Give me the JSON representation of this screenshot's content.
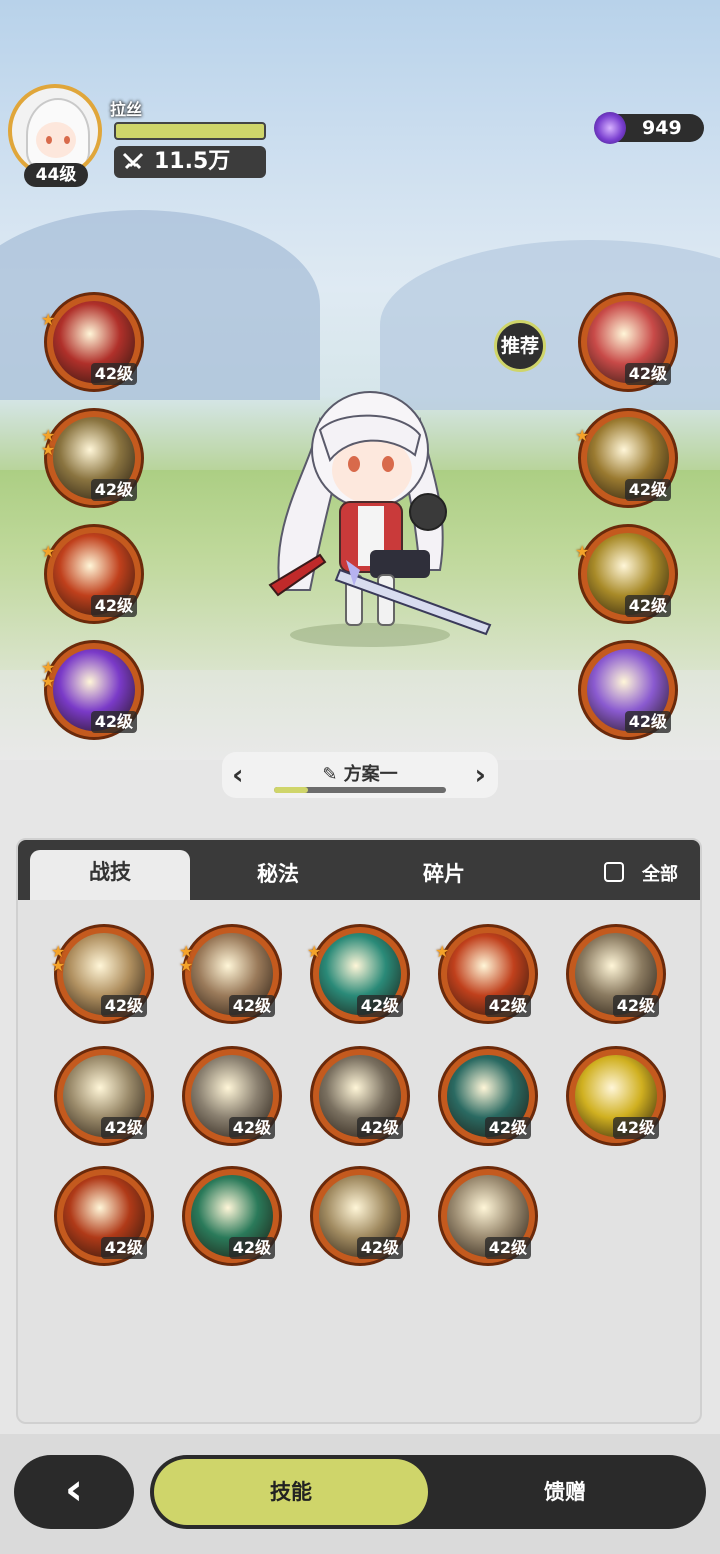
{
  "player": {
    "name": "拉丝",
    "level": "44级",
    "power": "11.5万",
    "hp_fraction": 1.0
  },
  "currency": {
    "value": "949",
    "icon": "purple-crystal-icon"
  },
  "recommend_label": "推荐",
  "left_skills": [
    {
      "level": "42级",
      "stars": 1,
      "icon": "sword-strike-icon",
      "color": "#b0302a"
    },
    {
      "level": "42级",
      "stars": 2,
      "icon": "slash-icon",
      "color": "#8a7440"
    },
    {
      "level": "42级",
      "stars": 1,
      "icon": "fire-rune-icon",
      "color": "#c0401c"
    },
    {
      "level": "42级",
      "stars": 2,
      "icon": "violet-orb-icon",
      "color": "#7a3ac8"
    }
  ],
  "right_skills": [
    {
      "level": "42级",
      "stars": 0,
      "icon": "red-sword-icon",
      "color": "#c84a48"
    },
    {
      "level": "42级",
      "stars": 1,
      "icon": "golden-sigil-icon",
      "color": "#9a7a30"
    },
    {
      "level": "42级",
      "stars": 1,
      "icon": "eye-icon",
      "color": "#a88a28"
    },
    {
      "level": "42级",
      "stars": 0,
      "icon": "purple-vortex-icon",
      "color": "#8a5ad0"
    }
  ],
  "plan": {
    "title": "方案一",
    "progress": 0.2
  },
  "tabs": [
    "战技",
    "秘法",
    "碎片"
  ],
  "all_label": "全部",
  "grid_skills": [
    {
      "level": "42级",
      "stars": 2,
      "icon": "burst-icon",
      "color": "#b09060"
    },
    {
      "level": "42级",
      "stars": 2,
      "icon": "explosion-icon",
      "color": "#9a7a5a"
    },
    {
      "level": "42级",
      "stars": 1,
      "icon": "teal-slash-icon",
      "color": "#2a8a78"
    },
    {
      "level": "42级",
      "stars": 1,
      "icon": "flame-icon",
      "color": "#c0401c"
    },
    {
      "level": "42级",
      "stars": 0,
      "icon": "crescent-icon",
      "color": "#8a7a60"
    },
    {
      "level": "42级",
      "stars": 0,
      "icon": "sword-up-icon",
      "color": "#9a8a6a"
    },
    {
      "level": "42级",
      "stars": 0,
      "icon": "wind-slash-icon",
      "color": "#8a8070"
    },
    {
      "level": "42级",
      "stars": 0,
      "icon": "leap-icon",
      "color": "#7a7060"
    },
    {
      "level": "42级",
      "stars": 0,
      "icon": "web-icon",
      "color": "#2a6a62"
    },
    {
      "level": "42级",
      "stars": 0,
      "icon": "gold-gem-icon",
      "color": "#d0b020"
    },
    {
      "level": "42级",
      "stars": 0,
      "icon": "red-arc-icon",
      "color": "#b03a18"
    },
    {
      "level": "42级",
      "stars": 0,
      "icon": "green-sword-icon",
      "color": "#2a7a5a"
    },
    {
      "level": "42级",
      "stars": 0,
      "icon": "whirlwind-icon",
      "color": "#a08a60"
    },
    {
      "level": "42级",
      "stars": 0,
      "icon": "beast-icon",
      "color": "#9a8a70"
    }
  ],
  "bottom": {
    "skill_tab": "技能",
    "gift_tab": "馈赠"
  }
}
